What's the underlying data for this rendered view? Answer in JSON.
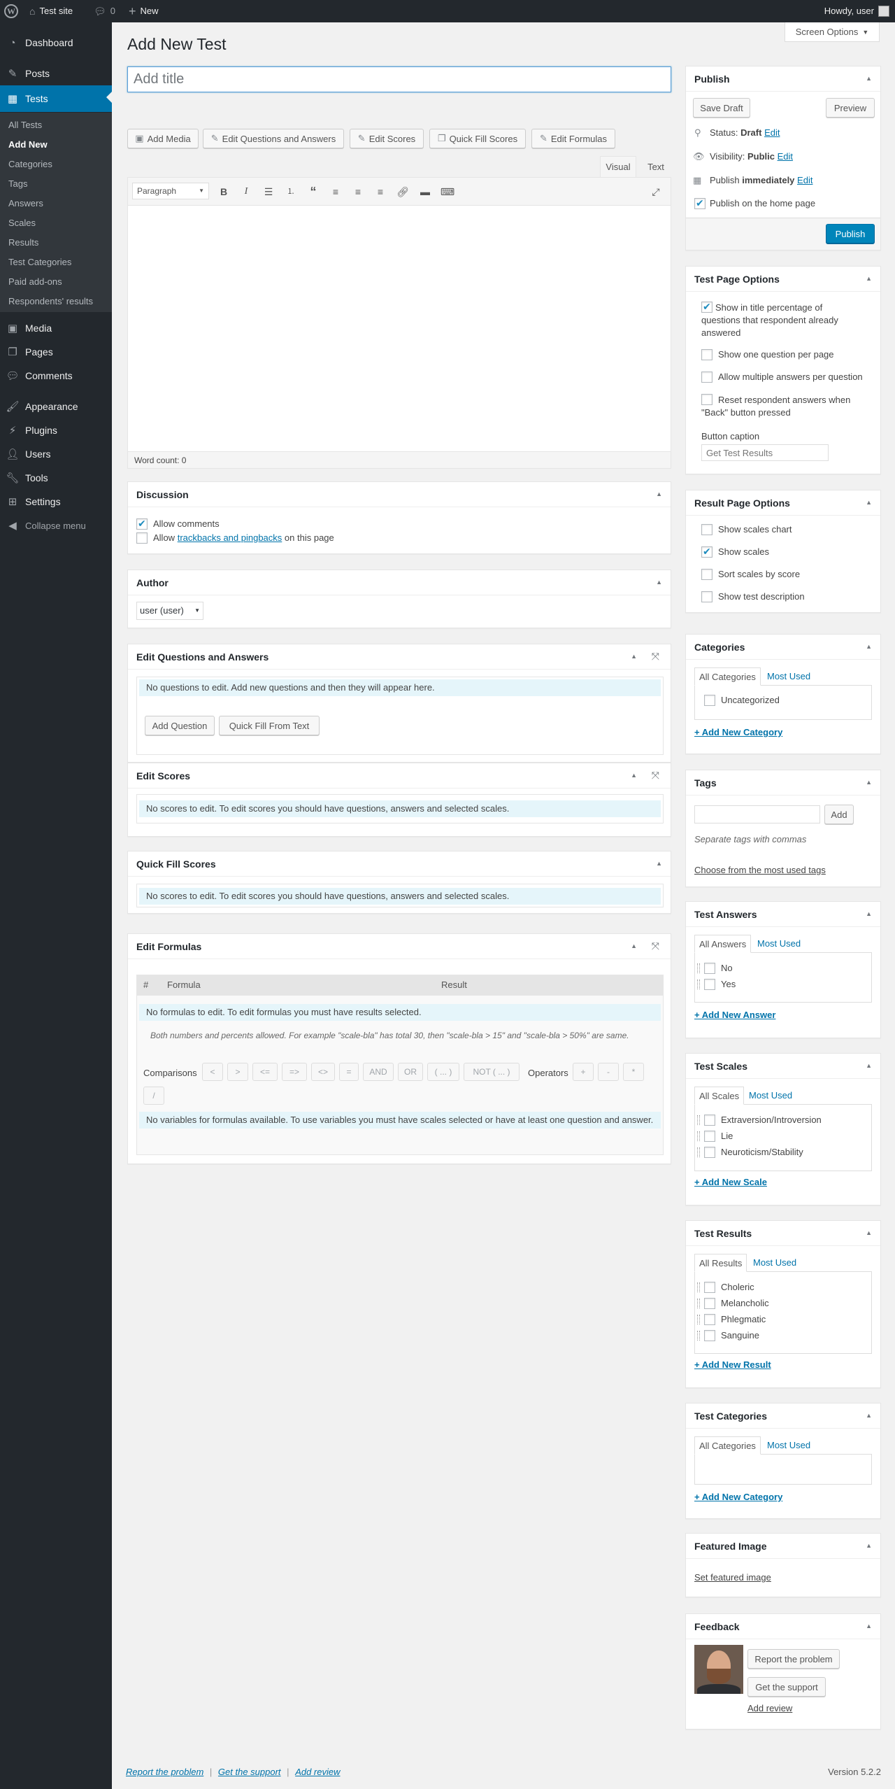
{
  "adminbar": {
    "site_name": "Test site",
    "comments_count": "0",
    "new_label": "New",
    "howdy": "Howdy, user"
  },
  "sidebar": {
    "items": [
      {
        "label": "Dashboard",
        "icon": "dashboard-icon"
      },
      {
        "label": "Posts",
        "icon": "pin-icon"
      },
      {
        "label": "Tests",
        "icon": "tests-icon"
      },
      {
        "label": "Media",
        "icon": "media-icon"
      },
      {
        "label": "Pages",
        "icon": "pages-icon"
      },
      {
        "label": "Comments",
        "icon": "comments-icon"
      },
      {
        "label": "Appearance",
        "icon": "brush-icon"
      },
      {
        "label": "Plugins",
        "icon": "plug-icon"
      },
      {
        "label": "Users",
        "icon": "users-icon"
      },
      {
        "label": "Tools",
        "icon": "wrench-icon"
      },
      {
        "label": "Settings",
        "icon": "settings-icon"
      }
    ],
    "submenu": [
      "All Tests",
      "Add New",
      "Categories",
      "Tags",
      "Answers",
      "Scales",
      "Results",
      "Test Categories",
      "Paid add-ons",
      "Respondents' results"
    ],
    "collapse": "Collapse menu"
  },
  "page": {
    "title": "Add New Test",
    "screen_options": "Screen Options",
    "title_placeholder": "Add title"
  },
  "media_buttons": [
    "Add Media",
    "Edit Questions and Answers",
    "Edit Scores",
    "Quick Fill Scores",
    "Edit Formulas"
  ],
  "editor": {
    "tab_visual": "Visual",
    "tab_text": "Text",
    "format": "Paragraph",
    "word_count": "Word count: 0"
  },
  "discussion": {
    "title": "Discussion",
    "allow_comments": "Allow comments",
    "allow_prefix": "Allow",
    "trackbacks_link": "trackbacks and pingbacks",
    "allow_suffix": "on this page"
  },
  "author": {
    "title": "Author",
    "value": "user (user)"
  },
  "edit_qa": {
    "title": "Edit Questions and Answers",
    "notice": "No questions to edit. Add new questions and then they will appear here.",
    "add_question": "Add Question",
    "quick_fill": "Quick Fill From Text"
  },
  "edit_scores": {
    "title": "Edit Scores",
    "notice": "No scores to edit. To edit scores you should have questions, answers and selected scales."
  },
  "quick_fill_scores": {
    "title": "Quick Fill Scores",
    "notice": "No scores to edit. To edit scores you should have questions, answers and selected scales."
  },
  "edit_formulas": {
    "title": "Edit Formulas",
    "col_num": "#",
    "col_formula": "Formula",
    "col_result": "Result",
    "notice": "No formulas to edit. To edit formulas you must have results selected.",
    "hint": "Both numbers and percents allowed. For example \"scale-bla\" has total 30, then \"scale-bla > 15\" and \"scale-bla > 50%\" are same.",
    "comparisons_label": "Comparisons",
    "comparisons": [
      "<",
      ">",
      "<=",
      "=>",
      "<>",
      "=",
      "AND",
      "OR",
      "( ... )",
      "NOT ( ... )"
    ],
    "operators_label": "Operators",
    "operators": [
      "+",
      "-",
      "*",
      "/"
    ],
    "vars_notice": "No variables for formulas available. To use variables you must have scales selected or have at least one question and answer."
  },
  "publish": {
    "title": "Publish",
    "save_draft": "Save Draft",
    "preview": "Preview",
    "status_label": "Status:",
    "status_value": "Draft",
    "visibility_label": "Visibility:",
    "visibility_value": "Public",
    "publish_label": "Publish",
    "publish_value": "immediately",
    "edit": "Edit",
    "home_page": "Publish on the home page",
    "publish_button": "Publish"
  },
  "test_page_options": {
    "title": "Test Page Options",
    "opt1": "Show in title percentage of questions that respondent already answered",
    "opt2": "Show one question per page",
    "opt3": "Allow multiple answers per question",
    "opt4": "Reset respondent answers when \"Back\" button pressed",
    "caption_label": "Button caption",
    "caption_placeholder": "Get Test Results"
  },
  "result_page_options": {
    "title": "Result Page Options",
    "opt1": "Show scales chart",
    "opt2": "Show scales",
    "opt3": "Sort scales by score",
    "opt4": "Show test description"
  },
  "categories": {
    "title": "Categories",
    "tab_all": "All Categories",
    "tab_most": "Most Used",
    "items": [
      "Uncategorized"
    ],
    "add_new": "+ Add New Category"
  },
  "tags": {
    "title": "Tags",
    "add": "Add",
    "hint": "Separate tags with commas",
    "choose": "Choose from the most used tags"
  },
  "test_answers": {
    "title": "Test Answers",
    "tab_all": "All Answers",
    "tab_most": "Most Used",
    "items": [
      "No",
      "Yes"
    ],
    "add_new": "+ Add New Answer"
  },
  "test_scales": {
    "title": "Test Scales",
    "tab_all": "All Scales",
    "tab_most": "Most Used",
    "items": [
      "Extraversion/Introversion",
      "Lie",
      "Neuroticism/Stability"
    ],
    "add_new": "+ Add New Scale"
  },
  "test_results": {
    "title": "Test Results",
    "tab_all": "All Results",
    "tab_most": "Most Used",
    "items": [
      "Choleric",
      "Melancholic",
      "Phlegmatic",
      "Sanguine"
    ],
    "add_new": "+ Add New Result"
  },
  "test_categories": {
    "title": "Test Categories",
    "tab_all": "All Categories",
    "tab_most": "Most Used",
    "add_new": "+ Add New Category"
  },
  "featured_image": {
    "title": "Featured Image",
    "link": "Set featured image"
  },
  "feedback": {
    "title": "Feedback",
    "report": "Report the problem",
    "support": "Get the support",
    "review": "Add review"
  },
  "footer": {
    "report": "Report the problem",
    "support": "Get the support",
    "review": "Add review",
    "version": "Version 5.2.2"
  },
  "colors": {
    "accent": "#0073aa",
    "admin_bar": "#23282d",
    "primary_button": "#0085ba"
  }
}
